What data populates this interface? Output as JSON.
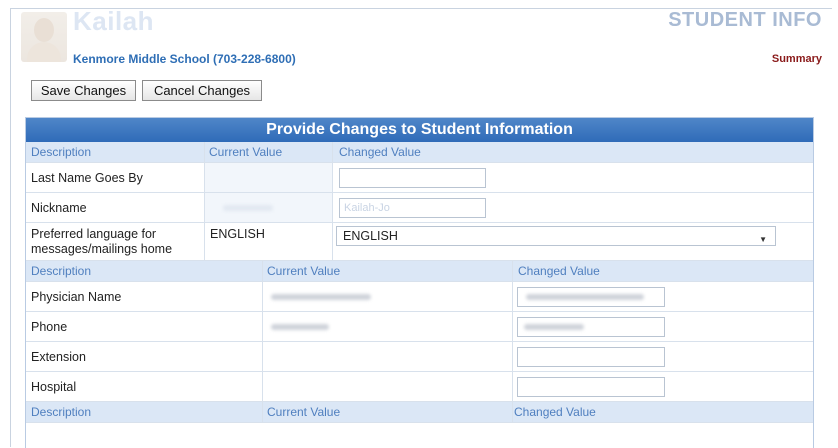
{
  "header": {
    "student_name": "Kailah",
    "school": "Kenmore Middle School (703-228-6800)",
    "page_title": "STUDENT INFO",
    "summary_link": "Summary"
  },
  "toolbar": {
    "save_label": "Save Changes",
    "cancel_label": "Cancel Changes"
  },
  "panel": {
    "title": "Provide Changes to Student Information",
    "section1": {
      "headers": {
        "description": "Description",
        "current": "Current Value",
        "changed": "Changed Value"
      },
      "rows": [
        {
          "label": "Last Name Goes By",
          "current": "",
          "changed": ""
        },
        {
          "label": "Nickname",
          "current": "",
          "changed": "Kailah-Jo"
        },
        {
          "label": "Preferred language for messages/mailings home",
          "current": "ENGLISH",
          "changed": "ENGLISH"
        }
      ]
    },
    "section2": {
      "headers": {
        "description": "Description",
        "current": "Current Value",
        "changed": "Changed Value"
      },
      "rows": [
        {
          "label": "Physician Name"
        },
        {
          "label": "Phone"
        },
        {
          "label": "Extension",
          "changed": ""
        },
        {
          "label": "Hospital",
          "changed": ""
        }
      ]
    },
    "section3": {
      "headers": {
        "description": "Description",
        "current": "Current Value",
        "changed": "Changed Value"
      }
    }
  },
  "icons": {
    "avatar": "student-photo",
    "select_arrow": "caret-down-icon"
  },
  "colors": {
    "accent": "#2f6bb8",
    "header_band": "#dbe7f6",
    "summary": "#8a1a1a",
    "school": "#2e6eb5"
  }
}
